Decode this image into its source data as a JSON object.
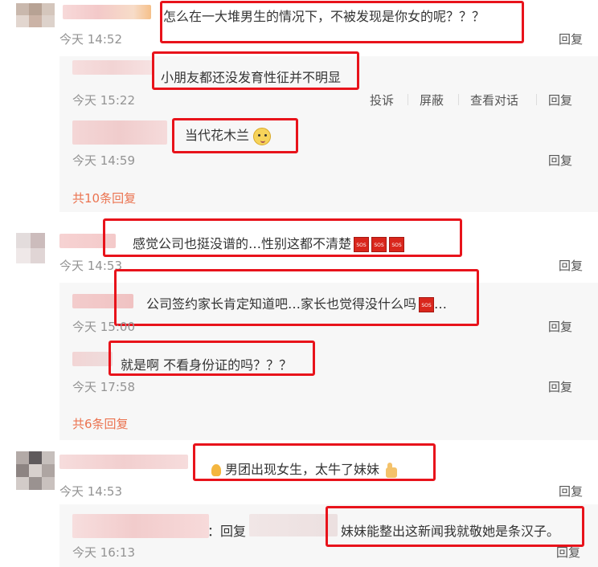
{
  "comments": [
    {
      "text": "怎么在一大堆男生的情况下，不被发现是你女的呢？？？",
      "time": "今天 14:52",
      "reply_label": "回复",
      "subreplies": [
        {
          "text": "小朋友都还没发育性征并不明显",
          "time": "今天 15:22",
          "actions": [
            "投诉",
            "屏蔽",
            "查看对话",
            "回复"
          ]
        },
        {
          "text": "当代花木兰",
          "emoji": "doge-emoji",
          "time": "今天 14:59",
          "reply_label": "回复"
        }
      ],
      "more_replies": "共10条回复"
    },
    {
      "text": "感觉公司也挺没谱的…性别这都不清楚",
      "sos_label": "SOS",
      "time": "今天 14:53",
      "reply_label": "回复",
      "subreplies": [
        {
          "text": "公司签约家长肯定知道吧…家长也觉得没什么吗",
          "ellipsis": "…",
          "time": "今天 15:00",
          "reply_label": "回复"
        },
        {
          "text": "就是啊 不看身份证的吗？？？",
          "time": "今天 17:58",
          "reply_label": "回复"
        }
      ],
      "more_replies": "共6条回复"
    },
    {
      "text": "男团出现女生，太牛了妹妹",
      "time": "今天 14:53",
      "reply_label": "回复",
      "subreplies": [
        {
          "prefix": "：回复",
          "text": "妹妹能整出这新闻我就敬她是条汉子。",
          "time": "今天 16:13",
          "reply_label": "回复"
        }
      ]
    }
  ],
  "colors": {
    "highlight_box": "#e8131b",
    "link_orange": "#eb7350",
    "time_gray": "#939393",
    "subreply_bg": "#f7f7f7"
  }
}
